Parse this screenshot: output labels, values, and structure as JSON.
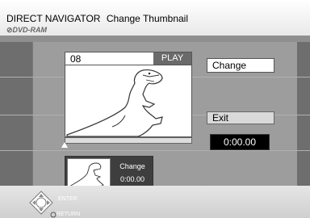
{
  "header": {
    "title": "DIRECT NAVIGATOR",
    "subtitle": "Change Thumbnail",
    "disc_label": "DVD-RAM"
  },
  "preview": {
    "number": "08",
    "mode": "PLAY"
  },
  "buttons": {
    "change": "Change",
    "exit": "Exit"
  },
  "time_display": "0:00.00",
  "thumbnail_card": {
    "label": "Change",
    "time": "0:00.00"
  },
  "footer": {
    "enter": "ENTER",
    "return": "RETURN"
  },
  "icons": {
    "disc": "disc-icon",
    "dpad": "dpad-icon",
    "return": "return-icon"
  }
}
